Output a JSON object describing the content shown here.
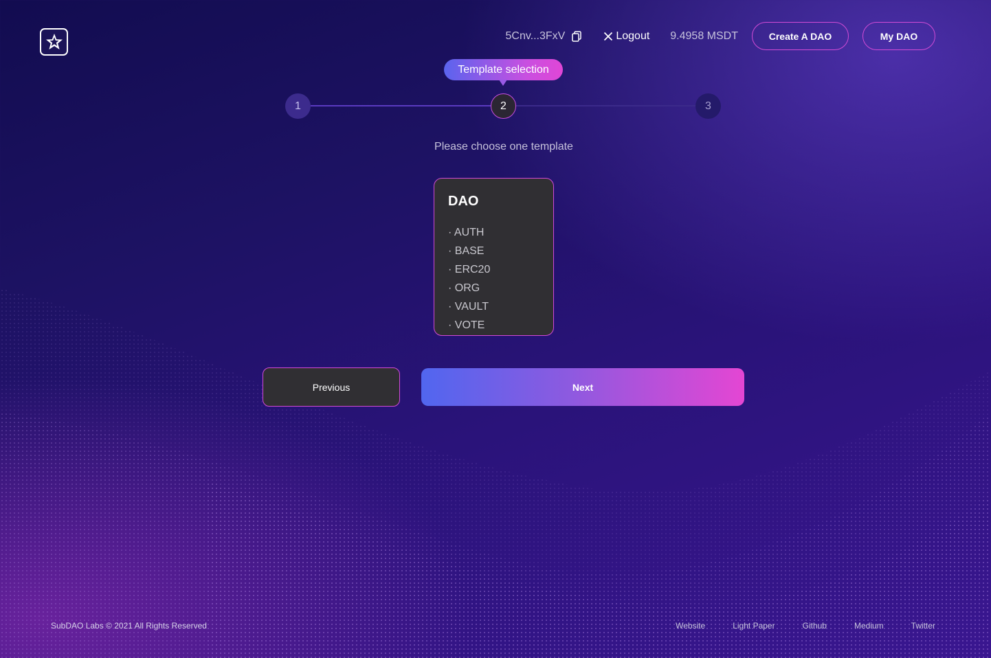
{
  "header": {
    "wallet_address": "5Cnv...3FxV",
    "logout_label": "Logout",
    "balance": "9.4958 MSDT",
    "create_dao_label": "Create A DAO",
    "my_dao_label": "My DAO"
  },
  "stepper": {
    "tooltip": "Template selection",
    "steps": [
      "1",
      "2",
      "3"
    ],
    "current_step": 2
  },
  "main": {
    "subtitle": "Please choose one template",
    "template": {
      "title": "DAO",
      "items": [
        "· AUTH",
        "· BASE",
        "· ERC20",
        "· ORG",
        "· VAULT",
        "· VOTE"
      ]
    },
    "previous_label": "Previous",
    "next_label": "Next"
  },
  "footer": {
    "copyright": "SubDAO Labs © 2021 All Rights Reserved",
    "links": [
      "Website",
      "Light Paper",
      "Github",
      "Medium",
      "Twitter"
    ]
  },
  "colors": {
    "accent_pink": "#d34bd6",
    "accent_blue": "#5166ef",
    "card_bg": "#302f33"
  }
}
